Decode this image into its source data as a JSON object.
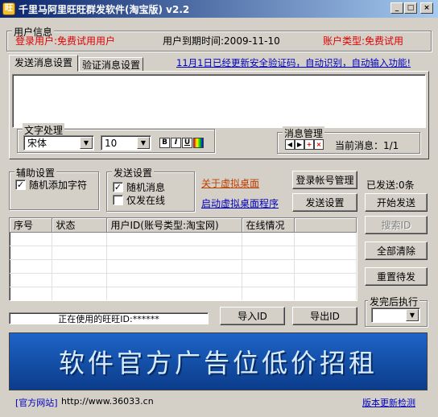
{
  "window": {
    "title": "千里马阿里旺旺群发软件(淘宝版) v2.2",
    "minimize": "_",
    "maximize": "□",
    "close": "×"
  },
  "user_info": {
    "group_title": "用户信息",
    "login_user": "登录用户:免费试用用户",
    "expiry": "用户到期时间:2009-11-10",
    "account_type": "账户类型:免费试用"
  },
  "tabs": [
    {
      "label": "发送消息设置"
    },
    {
      "label": "验证消息设置"
    }
  ],
  "notice_link": "11月1日已经更新安全验证码，自动识别，自动输入功能!",
  "text_processing": {
    "group_title": "文字处理",
    "font_value": "宋体",
    "size_value": "10",
    "bold": "B",
    "italic": "I",
    "underline": "U"
  },
  "message_manage": {
    "group_title": "消息管理",
    "current_label": "当前消息：1/1"
  },
  "assist": {
    "group_title": "辅助设置",
    "random_char_label": "随机添加字符",
    "random_char_checked": true
  },
  "send_settings": {
    "group_title": "发送设置",
    "random_msg_label": "随机消息",
    "random_msg_checked": true,
    "online_only_label": "仅发在线",
    "online_only_checked": false
  },
  "links": {
    "about_virtual_desktop": "关于虚拟桌面",
    "start_virtual_desktop": "启动虚拟桌面程序"
  },
  "buttons": {
    "login_manage": "登录帐号管理",
    "send_settings": "发送设置",
    "start_send": "开始发送",
    "search_id": "搜索ID",
    "clear_all": "全部清除",
    "reset_pending": "重置待发",
    "import_id": "导入ID",
    "export_id": "导出ID"
  },
  "sent_count": "已发送:0条",
  "table": {
    "columns": [
      "序号",
      "状态",
      "用户ID(账号类型:淘宝网)",
      "在线情况",
      ""
    ],
    "rows": []
  },
  "status_bar": {
    "current_wangwang": "正在使用的旺旺ID:******"
  },
  "after_send": {
    "group_title": "发完后执行",
    "value": ""
  },
  "banner": {
    "text": "软件官方广告位低价招租"
  },
  "footer": {
    "site_label": "[官方网站]",
    "site_url": "http://www.36033.cn",
    "update_check": "版本更新检测"
  },
  "colors": {
    "title_start": "#0a246a",
    "title_end": "#a6caf0",
    "accent_red": "#e00000",
    "link_blue": "#0000c0",
    "banner_bg": "#1450a8",
    "orange_link": "#c04000"
  }
}
